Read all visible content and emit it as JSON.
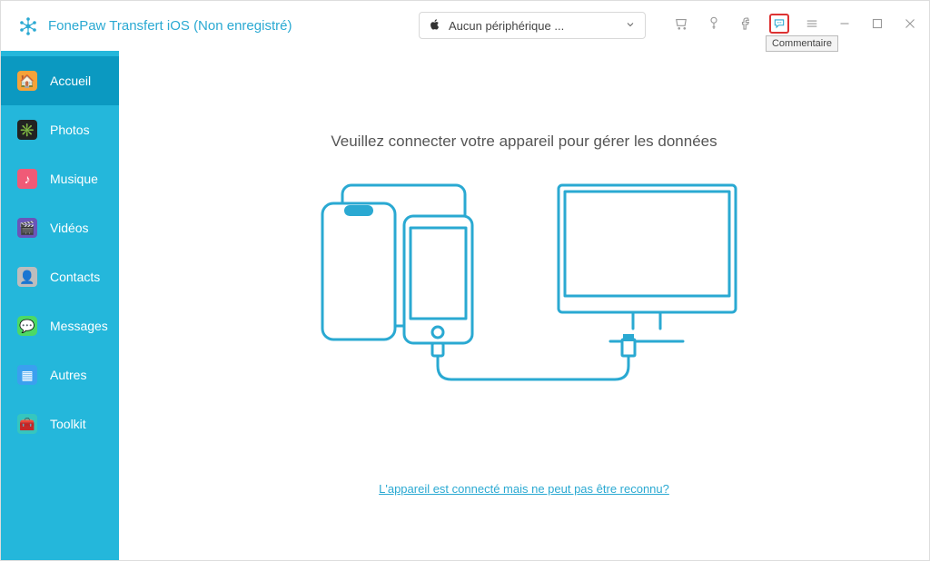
{
  "titlebar": {
    "app_title": "FonePaw Transfert iOS (Non enregistré)",
    "device_selector": "Aucun périphérique ...",
    "tooltip": "Commentaire"
  },
  "sidebar": {
    "items": [
      {
        "label": "Accueil"
      },
      {
        "label": "Photos"
      },
      {
        "label": "Musique"
      },
      {
        "label": "Vidéos"
      },
      {
        "label": "Contacts"
      },
      {
        "label": "Messages"
      },
      {
        "label": "Autres"
      },
      {
        "label": "Toolkit"
      }
    ]
  },
  "content": {
    "heading": "Veuillez connecter votre appareil pour gérer les données",
    "hint_link": "L'appareil est connecté mais ne peut pas être reconnu?"
  }
}
